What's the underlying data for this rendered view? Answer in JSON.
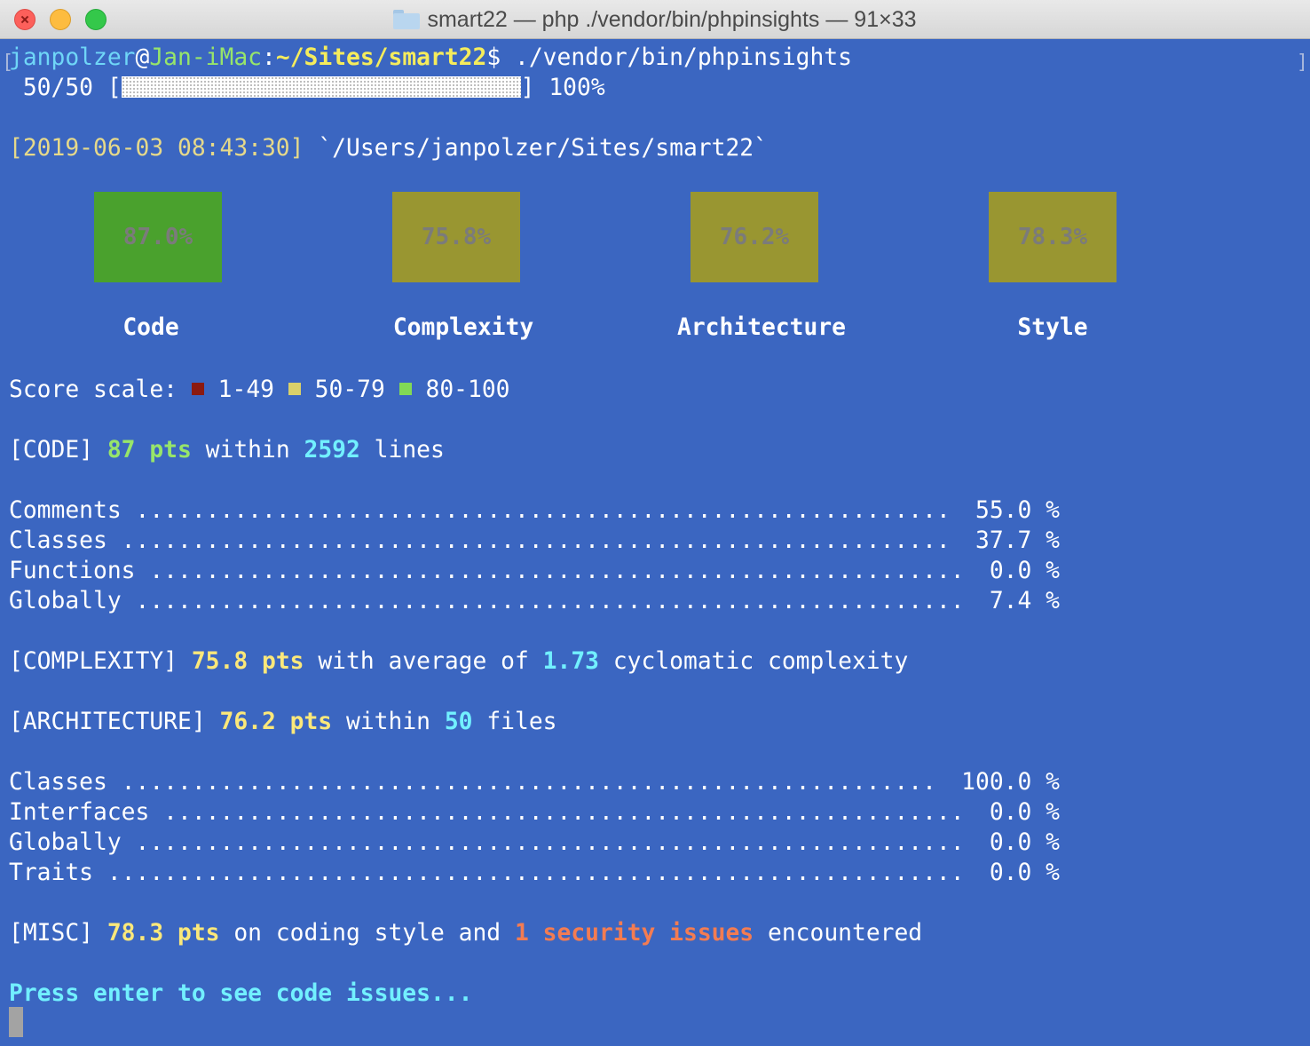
{
  "window": {
    "title": "smart22 — php ./vendor/bin/phpinsights — 91×33"
  },
  "prompt": {
    "user": "janpolzer",
    "at": "@",
    "host": "Jan-iMac",
    "colon": ":",
    "path": "~/Sites/smart22",
    "dollar": "$",
    "command": " ./vendor/bin/phpinsights"
  },
  "progress": {
    "count": " 50/50 [",
    "end": "] ",
    "percent_label": "100%",
    "fraction": 1.0
  },
  "timestamp": {
    "time": "[2019-06-03 08:43:30]",
    "path": " `/Users/janpolzer/Sites/smart22`"
  },
  "scores": [
    {
      "value": "87.0%",
      "label": "Code",
      "color": "#4aa12d"
    },
    {
      "value": "75.8%",
      "label": "Complexity",
      "color": "#999631"
    },
    {
      "value": "76.2%",
      "label": "Architecture",
      "color": "#999631"
    },
    {
      "value": "78.3%",
      "label": "Style",
      "color": "#999631"
    }
  ],
  "scale": {
    "label": "Score scale: ",
    "ranges": [
      {
        "text": " 1-49 ",
        "color": "#8b1a10"
      },
      {
        "text": " 50-79 ",
        "color": "#d9d06a"
      },
      {
        "text": " 80-100",
        "color": "#82d955"
      }
    ]
  },
  "code": {
    "tag": "[CODE] ",
    "pts": "87 pts",
    "mid": " within ",
    "lines": "2592",
    "end": " lines"
  },
  "code_rows": [
    {
      "name": "Comments",
      "value": "55.0 %"
    },
    {
      "name": "Classes",
      "value": "37.7 %"
    },
    {
      "name": "Functions",
      "value": "0.0 %"
    },
    {
      "name": "Globally",
      "value": "7.4 %"
    }
  ],
  "complexity": {
    "tag": "[COMPLEXITY] ",
    "pts": "75.8 pts",
    "mid": " with average of ",
    "avg": "1.73",
    "end": " cyclomatic complexity"
  },
  "architecture": {
    "tag": "[ARCHITECTURE] ",
    "pts": "76.2 pts",
    "mid": " within ",
    "files": "50",
    "end": " files"
  },
  "arch_rows": [
    {
      "name": "Classes",
      "value": "100.0 %"
    },
    {
      "name": "Interfaces",
      "value": "0.0 %"
    },
    {
      "name": "Globally",
      "value": "0.0 %"
    },
    {
      "name": "Traits",
      "value": "0.0 %"
    }
  ],
  "misc": {
    "tag": "[MISC] ",
    "pts": "78.3 pts",
    "mid": " on coding style and ",
    "count": "1",
    "issues": " security issues",
    "end": " encountered"
  },
  "footer": {
    "press": "Press enter to see code issues..."
  }
}
